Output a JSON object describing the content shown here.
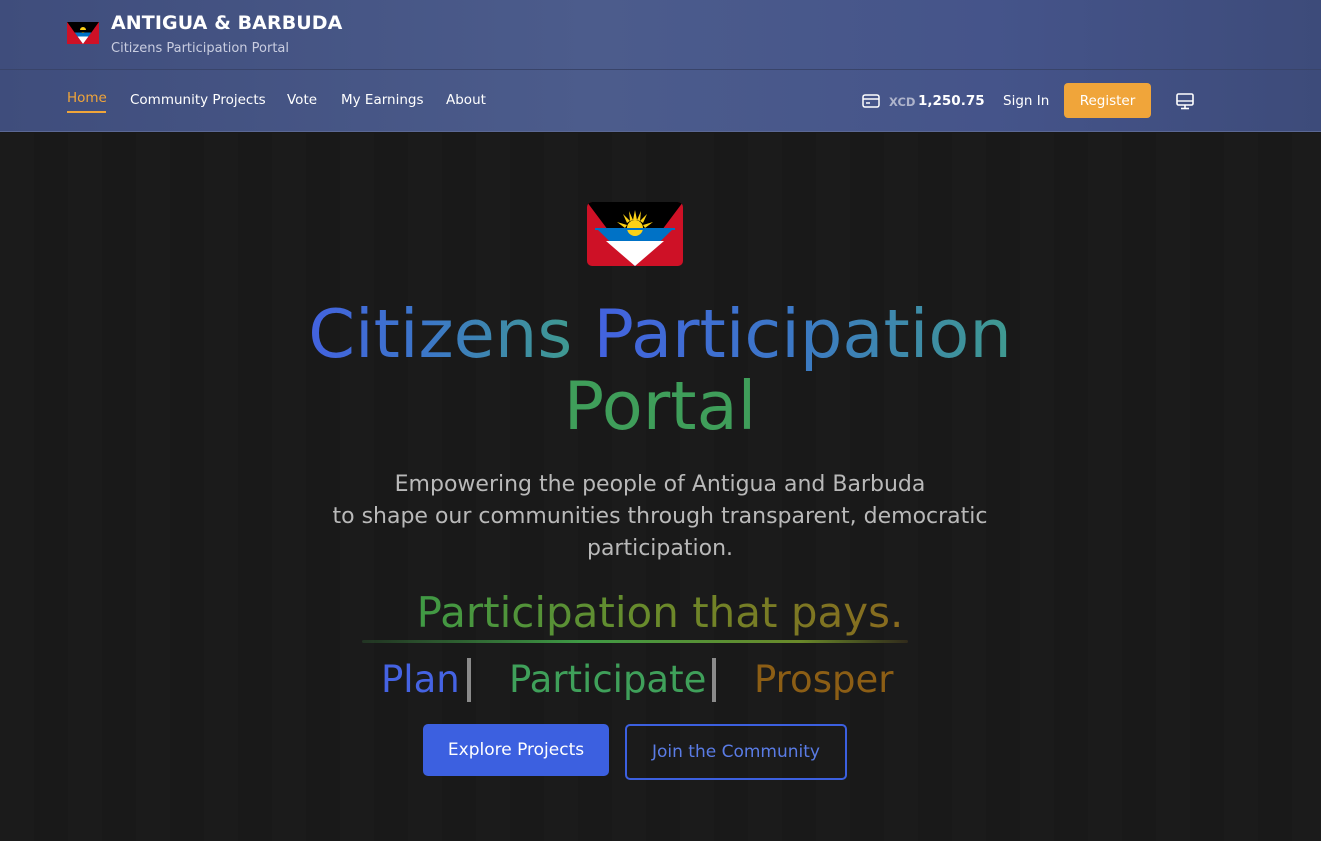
{
  "brand": {
    "title": "ANTIGUA & BARBUDA",
    "subtitle": "Citizens Participation Portal",
    "flag_icon": "antigua-barbuda-flag-icon"
  },
  "nav": {
    "items": [
      {
        "label": "Home",
        "active": true
      },
      {
        "label": "Community Projects",
        "active": false
      },
      {
        "label": "Vote",
        "active": false
      },
      {
        "label": "My Earnings",
        "active": false
      },
      {
        "label": "About",
        "active": false
      }
    ]
  },
  "wallet": {
    "icon": "credit-card-icon",
    "currency": "XCD",
    "amount": "1,250.75"
  },
  "auth": {
    "signin_label": "Sign In",
    "register_label": "Register"
  },
  "display_toggle_icon": "monitor-icon",
  "hero": {
    "title_line1_a": "Citizens",
    "title_line1_b": "Participation",
    "title_line2": "Portal",
    "description_line1": "Empowering the people of Antigua and Barbuda",
    "description_line2": "to shape our communities through transparent, democratic",
    "description_line3": "participation.",
    "tagline": "Participation that pays.",
    "pillars": [
      "Plan",
      "Participate",
      "Prosper"
    ],
    "primary_cta": "Explore Projects",
    "secondary_cta": "Join the Community"
  },
  "colors": {
    "accent_orange": "#f0a53a",
    "primary_blue": "#3c60e0",
    "header_bg": "#4c5c8c",
    "page_bg": "#181818",
    "pillar_plan": "#4563e3",
    "pillar_participate": "#3fa05a",
    "pillar_prosper": "#8c5e15"
  }
}
